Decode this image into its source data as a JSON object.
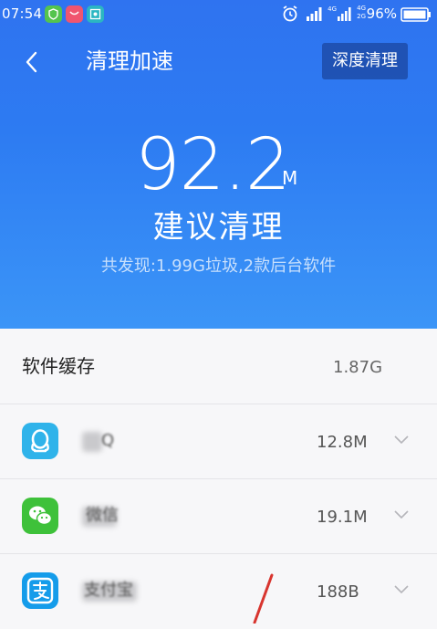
{
  "status_bar": {
    "time": "07:54",
    "network_top": "4G",
    "network_top_2": "4G",
    "network_bottom_2": "2G",
    "battery": "96%"
  },
  "header": {
    "title": "清理加速",
    "deep_clean_label": "深度清理"
  },
  "summary": {
    "size_value": "92.2",
    "size_unit": "M",
    "suggestion": "建议清理",
    "found_text": "共发现:1.99G垃圾,2款后台软件"
  },
  "category": {
    "title": "软件缓存",
    "size": "1.87G"
  },
  "apps": [
    {
      "name_visible": "Q",
      "size": "12.8M",
      "icon": "qq-icon",
      "color": "#2fb3ea"
    },
    {
      "name_visible": "微信",
      "size": "19.1M",
      "icon": "wechat-icon",
      "color": "#3ec13a"
    },
    {
      "name_visible": "支付宝",
      "size": "188B",
      "icon": "alipay-icon",
      "color": "#159cea"
    }
  ],
  "colors": {
    "header_gradient_top": "#2f73f0",
    "header_gradient_bottom": "#3b95f7",
    "list_background": "#f4f4f6"
  }
}
